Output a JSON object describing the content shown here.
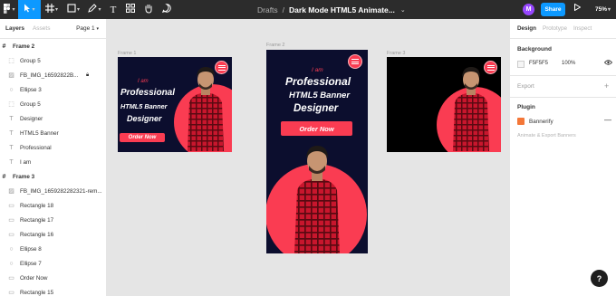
{
  "toolbar": {
    "main_menu_icon": "figma-logo-icon",
    "move_tool_icon": "cursor-icon",
    "frame_tool_icon": "hash-frame-icon",
    "shape_tool_icon": "square-icon",
    "pen_tool_icon": "pen-icon",
    "text_tool_icon": "text-icon",
    "resources_icon": "components-icon",
    "hand_tool_icon": "hand-icon",
    "comment_tool_icon": "comment-icon",
    "breadcrumb": "Drafts",
    "separator": "/",
    "file_name": "Dark Mode HTML5 Animate...",
    "avatar_initial": "M",
    "share_label": "Share",
    "zoom": "75%",
    "accent": "#0d99ff"
  },
  "left_panel": {
    "tabs": [
      "Layers",
      "Assets"
    ],
    "page": "Page 1",
    "layers": [
      {
        "label": "Frame 2",
        "icon": "frame-icon",
        "type": "frame"
      },
      {
        "label": "Group 5",
        "icon": "group-icon"
      },
      {
        "label": "FB_IMG_16592822B...",
        "icon": "image-icon",
        "locked": true
      },
      {
        "label": "Ellipse 3",
        "icon": "ellipse-icon"
      },
      {
        "label": "Group 5",
        "icon": "group-icon"
      },
      {
        "label": "Designer",
        "icon": "text-icon"
      },
      {
        "label": "HTML5 Banner",
        "icon": "text-icon"
      },
      {
        "label": "Professional",
        "icon": "text-icon"
      },
      {
        "label": "I am",
        "icon": "text-icon"
      },
      {
        "label": "Frame 3",
        "icon": "frame-icon",
        "type": "frame"
      },
      {
        "label": "FB_IMG_1659282282321-rem...",
        "icon": "image-icon"
      },
      {
        "label": "Rectangle 18",
        "icon": "rectangle-icon"
      },
      {
        "label": "Rectangle 17",
        "icon": "rectangle-icon"
      },
      {
        "label": "Rectangle 16",
        "icon": "rectangle-icon"
      },
      {
        "label": "Ellipse 8",
        "icon": "ellipse-icon"
      },
      {
        "label": "Ellipse 7",
        "icon": "ellipse-icon"
      },
      {
        "label": "Order Now",
        "icon": "rectangle-icon"
      },
      {
        "label": "Rectangle 15",
        "icon": "rectangle-icon"
      }
    ]
  },
  "canvas": {
    "frames": [
      {
        "label": "Frame 1",
        "iam": "I am",
        "line1": "Professional",
        "line2": "HTML5 Banner",
        "line3": "Designer",
        "cta": "Order Now",
        "bg": "#0c0e2e"
      },
      {
        "label": "Frame 2",
        "iam": "I am",
        "line1": "Professional",
        "line2": "HTML5 Banner",
        "line3": "Designer",
        "cta": "Order Now",
        "bg": "#0c0e2e"
      },
      {
        "label": "Frame 3",
        "bg": "#000000"
      }
    ],
    "accent": "#fa3c52"
  },
  "right_panel": {
    "tabs": [
      "Design",
      "Prototype",
      "Inspect"
    ],
    "background_title": "Background",
    "bg_hex": "F5F5F5",
    "bg_opacity": "100%",
    "export_title": "Export",
    "plugin_title": "Plugin",
    "plugin_name": "Bannerify",
    "plugin_sub": "Animate & Export Banners",
    "plugin_menu": "—"
  },
  "help_label": "?"
}
